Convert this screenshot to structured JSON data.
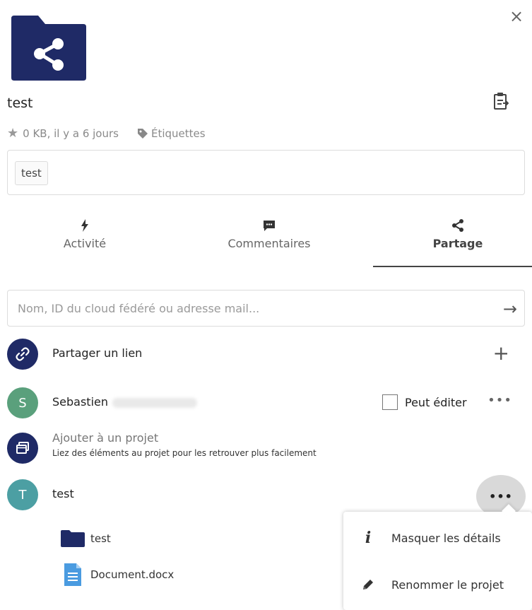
{
  "header": {
    "close_label": "×",
    "file_title": "test",
    "meta_info": "0 KB, il y a 6 jours",
    "tags_link": "Étiquettes",
    "tag_chip": "test"
  },
  "tabs": [
    {
      "label": "Activité",
      "active": false
    },
    {
      "label": "Commentaires",
      "active": false
    },
    {
      "label": "Partage",
      "active": true
    }
  ],
  "share": {
    "search_placeholder": "Nom, ID du cloud fédéré ou adresse mail...",
    "share_link_label": "Partager un lien",
    "user": {
      "initial": "S",
      "name": "Sebastien",
      "can_edit_label": "Peut éditer"
    },
    "project": {
      "title": "Ajouter à un projet",
      "description": "Liez des éléments au projet pour les retrouver plus facilement"
    },
    "project_item": {
      "initial": "T",
      "name": "test",
      "files": [
        {
          "name": "test",
          "icon": "folder-icon"
        },
        {
          "name": "Document.docx",
          "icon": "document-icon"
        }
      ]
    }
  },
  "menu": {
    "items": [
      {
        "label": "Masquer les détails",
        "icon": "info-icon"
      },
      {
        "label": "Renommer le projet",
        "icon": "pencil-icon"
      }
    ]
  },
  "colors": {
    "brand_dark": "#1f2a66",
    "teal": "#4c9fa3",
    "green": "#5aa07c",
    "doc_blue": "#4a9be0"
  }
}
